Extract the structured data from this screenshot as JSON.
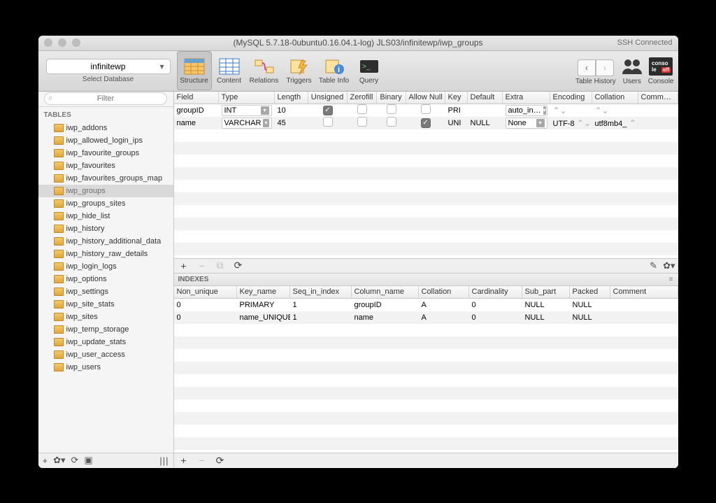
{
  "titlebar": {
    "title": "(MySQL 5.7.18-0ubuntu0.16.04.1-log) JLS03/infinitewp/iwp_groups",
    "ssh_status": "SSH Connected"
  },
  "toolbar": {
    "database": "infinitewp",
    "select_db_label": "Select Database",
    "buttons": [
      {
        "id": "structure",
        "label": "Structure"
      },
      {
        "id": "content",
        "label": "Content"
      },
      {
        "id": "relations",
        "label": "Relations"
      },
      {
        "id": "triggers",
        "label": "Triggers"
      },
      {
        "id": "tableinfo",
        "label": "Table Info"
      },
      {
        "id": "query",
        "label": "Query"
      }
    ],
    "table_history_label": "Table History",
    "users_label": "Users",
    "console_label": "Console"
  },
  "sidebar": {
    "filter_placeholder": "Filter",
    "tables_label": "TABLES",
    "tables": [
      "iwp_addons",
      "iwp_allowed_login_ips",
      "iwp_favourite_groups",
      "iwp_favourites",
      "iwp_favourites_groups_map",
      "iwp_groups",
      "iwp_groups_sites",
      "iwp_hide_list",
      "iwp_history",
      "iwp_history_additional_data",
      "iwp_history_raw_details",
      "iwp_login_logs",
      "iwp_options",
      "iwp_settings",
      "iwp_site_stats",
      "iwp_sites",
      "iwp_temp_storage",
      "iwp_update_stats",
      "iwp_user_access",
      "iwp_users"
    ],
    "selected": "iwp_groups"
  },
  "columns": {
    "headers": [
      "Field",
      "Type",
      "Length",
      "Unsigned",
      "Zerofill",
      "Binary",
      "Allow Null",
      "Key",
      "Default",
      "Extra",
      "Encoding",
      "Collation",
      "Comm…"
    ],
    "rows": [
      {
        "field": "groupID",
        "type": "INT",
        "length": "10",
        "unsigned": true,
        "zerofill": false,
        "binary": false,
        "allow_null": false,
        "key": "PRI",
        "def": "",
        "extra": "auto_in…",
        "encoding": "",
        "collation": ""
      },
      {
        "field": "name",
        "type": "VARCHAR",
        "length": "45",
        "unsigned": false,
        "zerofill": false,
        "binary": false,
        "allow_null": true,
        "key": "UNI",
        "def": "NULL",
        "extra": "None",
        "encoding": "UTF-8",
        "collation": "utf8mb4_"
      }
    ]
  },
  "indexes": {
    "title": "INDEXES",
    "headers": [
      "Non_unique",
      "Key_name",
      "Seq_in_index",
      "Column_name",
      "Collation",
      "Cardinality",
      "Sub_part",
      "Packed",
      "Comment"
    ],
    "rows": [
      {
        "non_unique": "0",
        "key_name": "PRIMARY",
        "seq": "1",
        "col": "groupID",
        "coll": "A",
        "card": "0",
        "sub": "NULL",
        "packed": "NULL",
        "comment": ""
      },
      {
        "non_unique": "0",
        "key_name": "name_UNIQUE",
        "seq": "1",
        "col": "name",
        "coll": "A",
        "card": "0",
        "sub": "NULL",
        "packed": "NULL",
        "comment": ""
      }
    ]
  }
}
